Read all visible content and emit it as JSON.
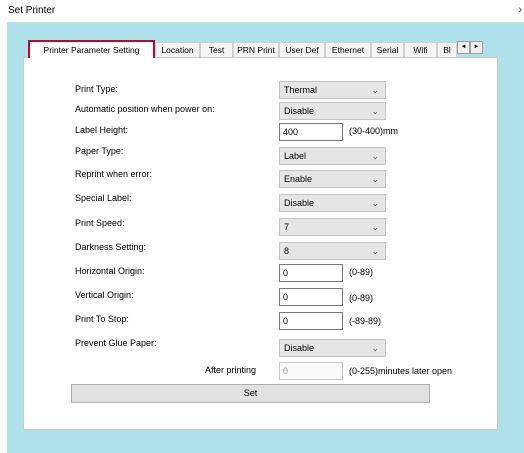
{
  "window": {
    "title": "Set Printer",
    "close_glyph": "›"
  },
  "tabs": [
    {
      "label": "Printer Parameter Setting",
      "active": true
    },
    {
      "label": "Location"
    },
    {
      "label": "Test"
    },
    {
      "label": "PRN Print"
    },
    {
      "label": "User Def"
    },
    {
      "label": "Ethernet"
    },
    {
      "label": "Serial"
    },
    {
      "label": "Wifi"
    },
    {
      "label": "Bl"
    }
  ],
  "tab_scroll": {
    "left": "◄",
    "right": "►"
  },
  "form": {
    "print_type": {
      "label": "Print Type:",
      "value": "Thermal"
    },
    "auto_position": {
      "label": "Automatic position when power on:",
      "value": "Disable"
    },
    "label_height": {
      "label": "Label Height:",
      "value": "400",
      "hint": "(30-400)mm"
    },
    "paper_type": {
      "label": "Paper Type:",
      "value": "Label"
    },
    "reprint_error": {
      "label": "Reprint when error:",
      "value": "Enable"
    },
    "special_label": {
      "label": "Special Label:",
      "value": "Disable"
    },
    "print_speed": {
      "label": "Print Speed:",
      "value": "7"
    },
    "darkness": {
      "label": "Darkness Setting:",
      "value": "8"
    },
    "horizontal_origin": {
      "label": "Horizontal Origin:",
      "value": "0",
      "hint": "(0-89)"
    },
    "vertical_origin": {
      "label": "Vertical Origin:",
      "value": "0",
      "hint": "(0-89)"
    },
    "print_to_stop": {
      "label": "Print To Stop:",
      "value": "0",
      "hint": "(-89-89)"
    },
    "prevent_glue": {
      "label": "Prevent Glue Paper:",
      "value": "Disable"
    },
    "after_printing": {
      "label": "After printing",
      "value": "0",
      "hint": "(0-255)minutes later open"
    }
  },
  "set_button": "Set",
  "chevron_glyph": "⌄",
  "colors": {
    "highlight": "#d0021b",
    "background": "#aee1e9"
  }
}
